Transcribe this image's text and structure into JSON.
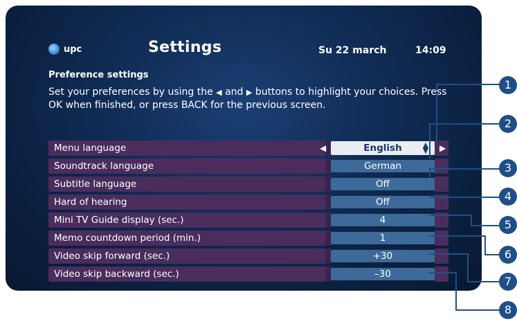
{
  "header": {
    "brand": "upc",
    "title": "Settings",
    "date": "Su 22 march",
    "time": "14:09"
  },
  "section": {
    "title": "Preference settings",
    "description_part1": "Set your preferences by using the",
    "left_glyph": "◀",
    "and_word": "and",
    "right_glyph": "▶",
    "description_part2": "buttons to highlight your choices. Press OK when finished, or press BACK for the previous screen."
  },
  "settings": [
    {
      "label": "Menu language",
      "value": "English"
    },
    {
      "label": "Soundtrack language",
      "value": "German"
    },
    {
      "label": "Subtitle language",
      "value": "Off"
    },
    {
      "label": "Hard of hearing",
      "value": "Off"
    },
    {
      "label": "Mini TV Guide display (sec.)",
      "value": "4"
    },
    {
      "label": "Memo countdown period (min.)",
      "value": "1"
    },
    {
      "label": "Video skip forward (sec.)",
      "value": "+30"
    },
    {
      "label": "Video skip backward (sec.)",
      "value": "–30"
    }
  ],
  "callouts": [
    "1",
    "2",
    "3",
    "4",
    "5",
    "6",
    "7",
    "8"
  ],
  "icons": {
    "spin": "spin-arrows-icon",
    "left": "arrow-left-icon",
    "right": "arrow-right-icon"
  },
  "colors": {
    "accent": "#1f4f86",
    "row_bar": "#4a2d5d",
    "value_box": "#3d6a99",
    "selected_box": "#e9edf2"
  }
}
